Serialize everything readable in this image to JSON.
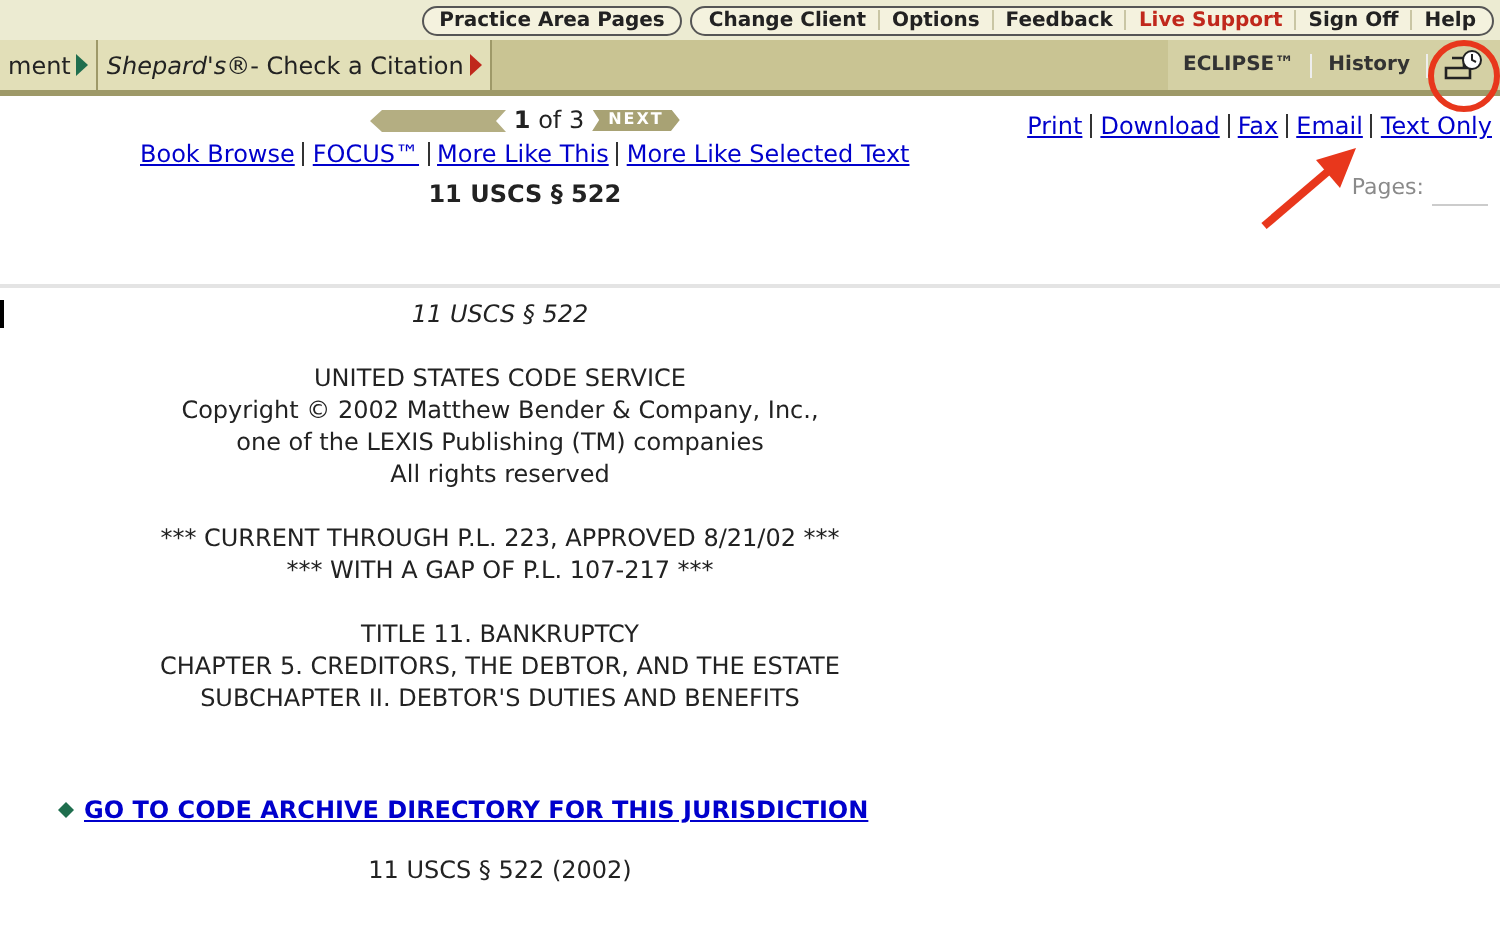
{
  "top_links": [
    [
      {
        "label": "Practice Area Pages",
        "kind": "normal"
      }
    ],
    [
      {
        "label": "Change Client",
        "kind": "normal"
      },
      {
        "label": "Options",
        "kind": "normal"
      },
      {
        "label": "Feedback",
        "kind": "normal"
      },
      {
        "label": "Live Support",
        "kind": "alert"
      },
      {
        "label": "Sign Off",
        "kind": "normal"
      },
      {
        "label": "Help",
        "kind": "normal"
      }
    ]
  ],
  "tabs": [
    {
      "label": "ment",
      "color": "#1f6e4e"
    },
    {
      "label": "*Shepard's*®- Check a Citation",
      "color": "#c0281c"
    }
  ],
  "right_tabs": [
    {
      "label": "ECLIPSE™"
    },
    {
      "label": "History"
    }
  ],
  "pager": {
    "current": "1",
    "total": "of 3",
    "next": "NEXT",
    "prev_disabled": true
  },
  "nav_links": [
    "Book Browse",
    "FOCUS™",
    "More Like This",
    "More Like Selected Text"
  ],
  "doc_title": "11 USCS § 522",
  "actions": [
    "Print",
    "Download",
    "Fax",
    "Email",
    "Text Only"
  ],
  "pages_label": "Pages:",
  "document": {
    "heading": "11 USCS § 522",
    "blocks": [
      [
        "UNITED STATES CODE SERVICE",
        "Copyright © 2002 Matthew Bender & Company, Inc.,",
        "one of the LEXIS Publishing (TM) companies",
        "All rights reserved"
      ],
      [
        "*** CURRENT THROUGH P.L. 223, APPROVED 8/21/02 ***",
        "*** WITH A GAP OF P.L. 107-217 ***"
      ],
      [
        "TITLE 11. BANKRUPTCY",
        "CHAPTER 5. CREDITORS, THE DEBTOR, AND THE ESTATE",
        "SUBCHAPTER II. DEBTOR'S DUTIES AND BENEFITS"
      ]
    ],
    "archive_link": "GO TO CODE ARCHIVE DIRECTORY FOR THIS JURISDICTION",
    "citation": "11 USCS § 522 (2002)"
  }
}
